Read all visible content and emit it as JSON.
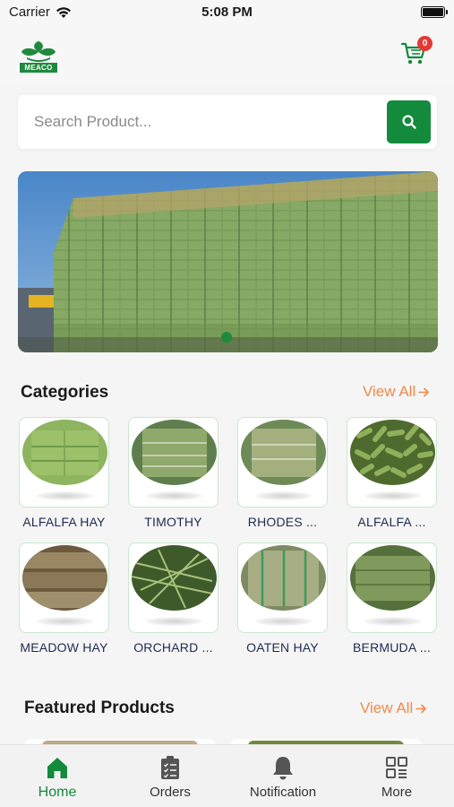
{
  "status_bar": {
    "carrier": "Carrier",
    "time": "5:08 PM"
  },
  "header": {
    "logo_text": "MEACO",
    "cart_count": "0"
  },
  "search": {
    "placeholder": "Search Product..."
  },
  "categories": {
    "title": "Categories",
    "view_all": "View All",
    "items": [
      {
        "label": "ALFALFA HAY"
      },
      {
        "label": "TIMOTHY"
      },
      {
        "label": "RHODES ..."
      },
      {
        "label": "ALFALFA ..."
      },
      {
        "label": "MEADOW HAY"
      },
      {
        "label": "ORCHARD ..."
      },
      {
        "label": "OATEN HAY"
      },
      {
        "label": "BERMUDA ..."
      }
    ]
  },
  "featured": {
    "title": "Featured Products",
    "view_all": "View All"
  },
  "tabs": [
    {
      "label": "Home",
      "icon": "home-icon"
    },
    {
      "label": "Orders",
      "icon": "clipboard-icon"
    },
    {
      "label": "Notification",
      "icon": "bell-icon"
    },
    {
      "label": "More",
      "icon": "grid-icon"
    }
  ],
  "colors": {
    "brand": "#148a3c",
    "accent": "#f08a4b",
    "badge": "#e53935"
  }
}
